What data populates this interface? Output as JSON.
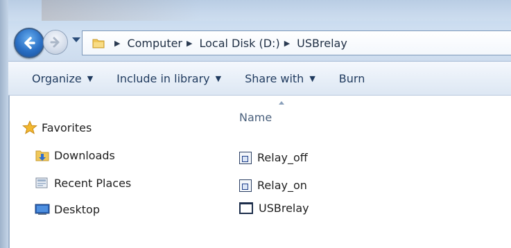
{
  "navigation": {
    "back_label": "Back",
    "forward_label": "Forward"
  },
  "address": {
    "crumbs": [
      "Computer",
      "Local Disk (D:)",
      "USBrelay"
    ]
  },
  "toolbar": {
    "organize": "Organize",
    "include_in_library": "Include in library",
    "share_with": "Share with",
    "burn": "Burn"
  },
  "sidebar": {
    "favorites": "Favorites",
    "items": [
      {
        "label": "Downloads",
        "icon": "downloads-folder-icon"
      },
      {
        "label": "Recent Places",
        "icon": "recent-places-icon"
      },
      {
        "label": "Desktop",
        "icon": "desktop-icon"
      }
    ]
  },
  "files": {
    "column_name": "Name",
    "items": [
      {
        "name": "Relay_off",
        "icon": "shortcut-icon"
      },
      {
        "name": "Relay_on",
        "icon": "shortcut-icon"
      },
      {
        "name": "USBrelay",
        "icon": "application-window-icon"
      }
    ]
  },
  "colors": {
    "accent": "#2a6fc4",
    "toolbar_text": "#1f3a5e",
    "favorites_star": "#f2b830"
  }
}
